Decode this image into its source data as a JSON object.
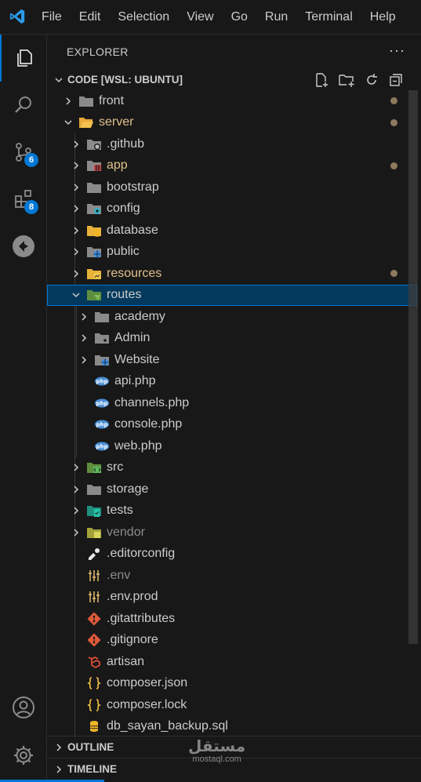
{
  "menubar": {
    "items": [
      "File",
      "Edit",
      "Selection",
      "View",
      "Go",
      "Run",
      "Terminal",
      "Help"
    ]
  },
  "activity": {
    "items": [
      {
        "name": "explorer-icon"
      },
      {
        "name": "search-icon"
      },
      {
        "name": "source-control-icon",
        "badge": "6"
      },
      {
        "name": "extensions-icon",
        "badge": "8"
      },
      {
        "name": "remote-explorer-icon"
      }
    ],
    "bottom": [
      {
        "name": "account-icon"
      },
      {
        "name": "settings-gear-icon"
      }
    ]
  },
  "explorer": {
    "title": "EXPLORER",
    "more": "···",
    "project": "CODE [WSL: UBUNTU]",
    "tree": [
      {
        "label": "front",
        "depth": 0,
        "type": "folder",
        "expanded": false,
        "icon": "folder",
        "modified": true
      },
      {
        "label": "server",
        "depth": 0,
        "type": "folder",
        "expanded": true,
        "icon": "folder-open",
        "modified": true,
        "style": "mod"
      },
      {
        "label": ".github",
        "depth": 1,
        "type": "folder",
        "expanded": false,
        "icon": "github-folder"
      },
      {
        "label": "app",
        "depth": 1,
        "type": "folder",
        "expanded": false,
        "icon": "app-folder",
        "modified": true,
        "style": "mod"
      },
      {
        "label": "bootstrap",
        "depth": 1,
        "type": "folder",
        "expanded": false,
        "icon": "folder"
      },
      {
        "label": "config",
        "depth": 1,
        "type": "folder",
        "expanded": false,
        "icon": "config-folder"
      },
      {
        "label": "database",
        "depth": 1,
        "type": "folder",
        "expanded": false,
        "icon": "database-folder"
      },
      {
        "label": "public",
        "depth": 1,
        "type": "folder",
        "expanded": false,
        "icon": "public-folder"
      },
      {
        "label": "resources",
        "depth": 1,
        "type": "folder",
        "expanded": false,
        "icon": "resources-folder",
        "modified": true,
        "style": "mod"
      },
      {
        "label": "routes",
        "depth": 1,
        "type": "folder",
        "expanded": true,
        "icon": "routes-folder",
        "selected": true
      },
      {
        "label": "academy",
        "depth": 2,
        "type": "folder",
        "expanded": false,
        "icon": "folder"
      },
      {
        "label": "Admin",
        "depth": 2,
        "type": "folder",
        "expanded": false,
        "icon": "admin-folder"
      },
      {
        "label": "Website",
        "depth": 2,
        "type": "folder",
        "expanded": false,
        "icon": "public-folder"
      },
      {
        "label": "api.php",
        "depth": 2,
        "type": "file",
        "icon": "php"
      },
      {
        "label": "channels.php",
        "depth": 2,
        "type": "file",
        "icon": "php"
      },
      {
        "label": "console.php",
        "depth": 2,
        "type": "file",
        "icon": "php"
      },
      {
        "label": "web.php",
        "depth": 2,
        "type": "file",
        "icon": "php"
      },
      {
        "label": "src",
        "depth": 1,
        "type": "folder",
        "expanded": false,
        "icon": "src-folder"
      },
      {
        "label": "storage",
        "depth": 1,
        "type": "folder",
        "expanded": false,
        "icon": "folder"
      },
      {
        "label": "tests",
        "depth": 1,
        "type": "folder",
        "expanded": false,
        "icon": "tests-folder"
      },
      {
        "label": "vendor",
        "depth": 1,
        "type": "folder",
        "expanded": false,
        "icon": "vendor-folder",
        "style": "dim"
      },
      {
        "label": ".editorconfig",
        "depth": 1,
        "type": "file",
        "icon": "editorconfig"
      },
      {
        "label": ".env",
        "depth": 1,
        "type": "file",
        "icon": "env",
        "style": "dim"
      },
      {
        "label": ".env.prod",
        "depth": 1,
        "type": "file",
        "icon": "env"
      },
      {
        "label": ".gitattributes",
        "depth": 1,
        "type": "file",
        "icon": "git"
      },
      {
        "label": ".gitignore",
        "depth": 1,
        "type": "file",
        "icon": "git"
      },
      {
        "label": "artisan",
        "depth": 1,
        "type": "file",
        "icon": "laravel"
      },
      {
        "label": "composer.json",
        "depth": 1,
        "type": "file",
        "icon": "json"
      },
      {
        "label": "composer.lock",
        "depth": 1,
        "type": "file",
        "icon": "json"
      },
      {
        "label": "db_sayan_backup.sql",
        "depth": 1,
        "type": "file",
        "icon": "sql"
      }
    ]
  },
  "sections": {
    "outline": "OUTLINE",
    "timeline": "TIMELINE"
  },
  "watermark": {
    "arabic": "مستقل",
    "latin": "mostaql.com"
  },
  "colors": {
    "accent": "#0078d4",
    "modified": "#e2c08d",
    "selection": "#04395e"
  }
}
